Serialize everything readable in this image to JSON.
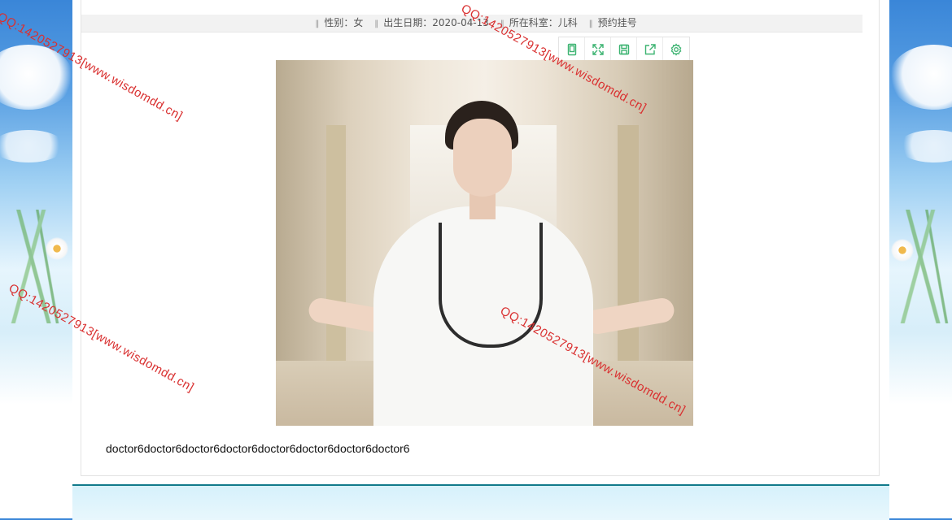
{
  "info_bar": {
    "items": [
      "性别：女",
      "出生日期：2020-04-13",
      "所在科室：儿科",
      "预约挂号"
    ]
  },
  "toolbar": {
    "buttons": [
      {
        "icon": "reader-icon"
      },
      {
        "icon": "fullscreen-icon"
      },
      {
        "icon": "save-icon"
      },
      {
        "icon": "share-icon"
      },
      {
        "icon": "settings-icon"
      }
    ],
    "accent_color": "#3cb371"
  },
  "content": {
    "caption": "doctor6doctor6doctor6doctor6doctor6doctor6doctor6doctor6"
  },
  "watermark": {
    "text": "QQ:1420527913[www.wisdomdd.cn]",
    "color": "#d93030"
  }
}
